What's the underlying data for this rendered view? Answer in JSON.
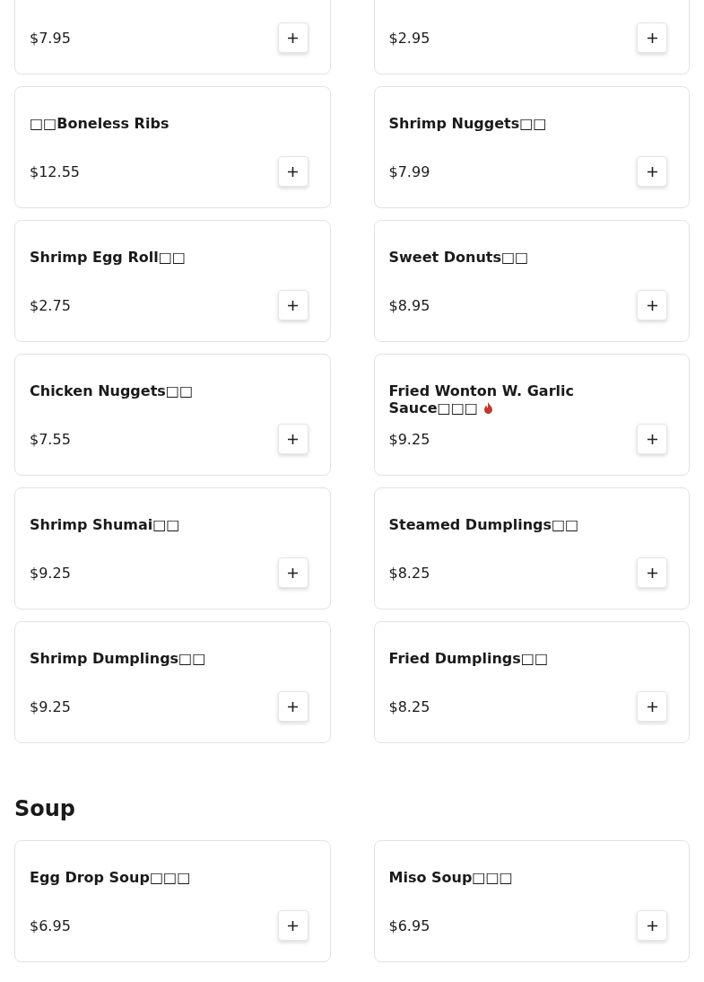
{
  "sections": [
    {
      "items": [
        {
          "price": "$7.95"
        },
        {
          "price": "$2.95"
        },
        {
          "name": "□□Boneless Ribs",
          "price": "$12.55",
          "spicy": false
        },
        {
          "name": "Shrimp Nuggets□□",
          "price": "$7.99",
          "spicy": false
        },
        {
          "name": "Shrimp Egg Roll□□",
          "price": "$2.75",
          "spicy": false
        },
        {
          "name": "Sweet Donuts□□",
          "price": "$8.95",
          "spicy": false
        },
        {
          "name": "Chicken Nuggets□□",
          "price": "$7.55",
          "spicy": false
        },
        {
          "name": "Fried Wonton W. Garlic Sauce□□□",
          "price": "$9.25",
          "spicy": true
        },
        {
          "name": "Shrimp Shumai□□",
          "price": "$9.25",
          "spicy": false
        },
        {
          "name": "Steamed Dumplings□□",
          "price": "$8.25",
          "spicy": false
        },
        {
          "name": "Shrimp Dumplings□□",
          "price": "$9.25",
          "spicy": false
        },
        {
          "name": "Fried Dumplings□□",
          "price": "$8.25",
          "spicy": false
        }
      ]
    },
    {
      "title": "Soup",
      "items": [
        {
          "name": "Egg Drop Soup□□□",
          "price": "$6.95",
          "spicy": false
        },
        {
          "name": "Miso Soup□□□",
          "price": "$6.95",
          "spicy": false
        }
      ]
    }
  ]
}
